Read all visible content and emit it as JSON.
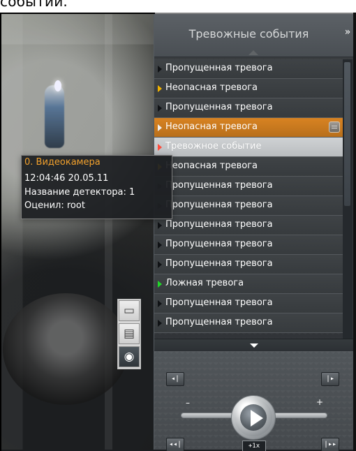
{
  "caption": {
    "text": "событий."
  },
  "tooltip": {
    "title": "0. Видеокамера",
    "time": "12:04:46 20.05.11",
    "detector": "Название детектора: 1",
    "reviewer": "Оценил: root"
  },
  "panel": {
    "title": "Тревожные события",
    "collapse_icon": "double-chevron-down-icon"
  },
  "events": [
    {
      "label": "Пропущенная тревога",
      "arrow": "black",
      "state": "normal"
    },
    {
      "label": "Неопасная тревога",
      "arrow": "yellow",
      "state": "normal"
    },
    {
      "label": "Пропущенная тревога",
      "arrow": "black",
      "state": "normal"
    },
    {
      "label": "Неопасная тревога",
      "arrow": "light",
      "state": "selected"
    },
    {
      "label": "Тревожное событие",
      "arrow": "red",
      "state": "highlighted"
    },
    {
      "label": "Неопасная тревога",
      "arrow": "yellow",
      "state": "normal"
    },
    {
      "label": "Пропущенная тревога",
      "arrow": "black",
      "state": "normal"
    },
    {
      "label": "Пропущенная тревога",
      "arrow": "black",
      "state": "normal"
    },
    {
      "label": "Пропущенная тревога",
      "arrow": "black",
      "state": "normal"
    },
    {
      "label": "Пропущенная тревога",
      "arrow": "black",
      "state": "normal"
    },
    {
      "label": "Пропущенная тревога",
      "arrow": "black",
      "state": "normal"
    },
    {
      "label": "Ложная тревога",
      "arrow": "green",
      "state": "normal"
    },
    {
      "label": "Пропущенная тревога",
      "arrow": "black",
      "state": "normal"
    },
    {
      "label": "Пропущенная тревога",
      "arrow": "black",
      "state": "normal"
    }
  ],
  "controls": {
    "prev_frame_icon": "step-back-icon",
    "next_frame_icon": "step-forward-icon",
    "rewind_icon": "rewind-icon",
    "fast_forward_icon": "fast-forward-icon",
    "play_icon": "play-icon",
    "speed": "+1x",
    "minus": "–",
    "plus": "+"
  },
  "side_tabs": {
    "monitor_icon": "monitor-icon",
    "archive_icon": "archive-icon",
    "camera_icon": "camera-icon"
  },
  "colors": {
    "selected": "#d88322",
    "highlighted": "#c4c7c9",
    "tooltip_title": "#f2a12d",
    "alarm_red": "#ff4a3a",
    "alarm_yellow": "#f1b200",
    "alarm_green": "#21d629"
  }
}
